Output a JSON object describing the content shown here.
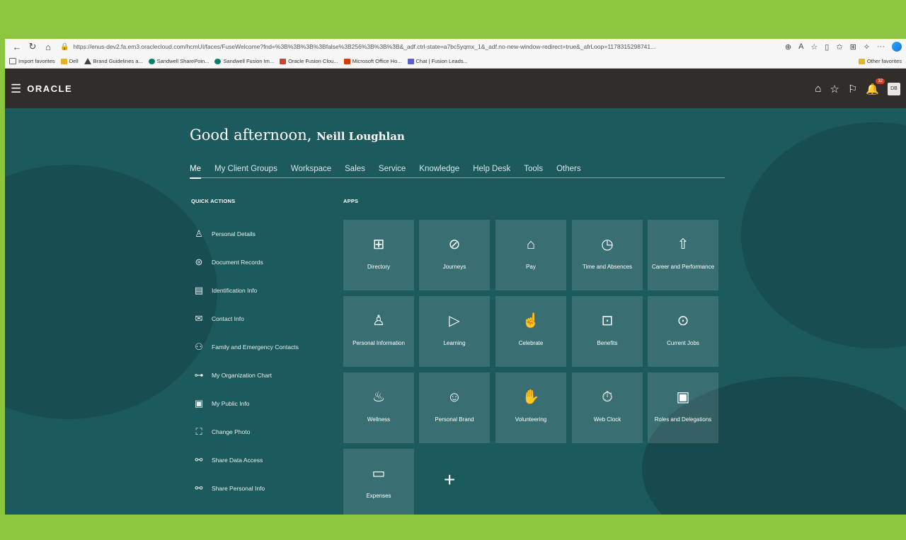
{
  "browser": {
    "url": "https://enus-dev2.fa.em3.oraclecloud.com/hcmUI/faces/FuseWelcome?fnd=%3B%3B%3B%3Bfalse%3B256%3B%3B%3B&_adf.ctrl-state=a7bc5yqmx_1&_adf.no-new-window-redirect=true&_afrLoop=1178315298741...",
    "favorites": [
      "Import favorites",
      "Dell",
      "Brand Guidelines a...",
      "Sandwell SharePoin...",
      "Sandwell Fusion Im...",
      "Oracle Fusion Clou...",
      "Microsoft Office Ho...",
      "Chat | Fusion Leads..."
    ],
    "other_favorites": "Other favorites"
  },
  "header": {
    "logo": "ORACLE",
    "notification_count": "32",
    "avatar": "DB"
  },
  "greeting": {
    "text": "Good afternoon, ",
    "name": "Neill Loughlan"
  },
  "tabs": [
    "Me",
    "My Client Groups",
    "Workspace",
    "Sales",
    "Service",
    "Knowledge",
    "Help Desk",
    "Tools",
    "Others"
  ],
  "quick_actions": {
    "title": "QUICK ACTIONS",
    "items": [
      {
        "label": "Personal Details",
        "icon": "person-icon"
      },
      {
        "label": "Document Records",
        "icon": "document-icon"
      },
      {
        "label": "Identification Info",
        "icon": "id-card-icon"
      },
      {
        "label": "Contact Info",
        "icon": "envelope-icon"
      },
      {
        "label": "Family and Emergency Contacts",
        "icon": "family-icon"
      },
      {
        "label": "My Organization Chart",
        "icon": "org-chart-icon"
      },
      {
        "label": "My Public Info",
        "icon": "badge-icon"
      },
      {
        "label": "Change Photo",
        "icon": "photo-icon"
      },
      {
        "label": "Share Data Access",
        "icon": "share-icon"
      },
      {
        "label": "Share Personal Info",
        "icon": "share-people-icon"
      }
    ]
  },
  "apps": {
    "title": "APPS",
    "items": [
      {
        "label": "Directory",
        "icon": "directory-icon"
      },
      {
        "label": "Journeys",
        "icon": "compass-icon"
      },
      {
        "label": "Pay",
        "icon": "bank-icon"
      },
      {
        "label": "Time and Absences",
        "icon": "clock-icon"
      },
      {
        "label": "Career and Performance",
        "icon": "career-icon"
      },
      {
        "label": "Personal Information",
        "icon": "person-icon"
      },
      {
        "label": "Learning",
        "icon": "play-icon"
      },
      {
        "label": "Celebrate",
        "icon": "thumbs-up-icon"
      },
      {
        "label": "Benefits",
        "icon": "gift-icon"
      },
      {
        "label": "Current Jobs",
        "icon": "briefcase-icon"
      },
      {
        "label": "Wellness",
        "icon": "wellness-icon"
      },
      {
        "label": "Personal Brand",
        "icon": "chat-person-icon"
      },
      {
        "label": "Volunteering",
        "icon": "volunteer-icon"
      },
      {
        "label": "Web Clock",
        "icon": "stopwatch-icon"
      },
      {
        "label": "Roles and Delegations",
        "icon": "badge-icon"
      },
      {
        "label": "Expenses",
        "icon": "wallet-icon"
      }
    ],
    "add_icon": "plus-icon"
  }
}
